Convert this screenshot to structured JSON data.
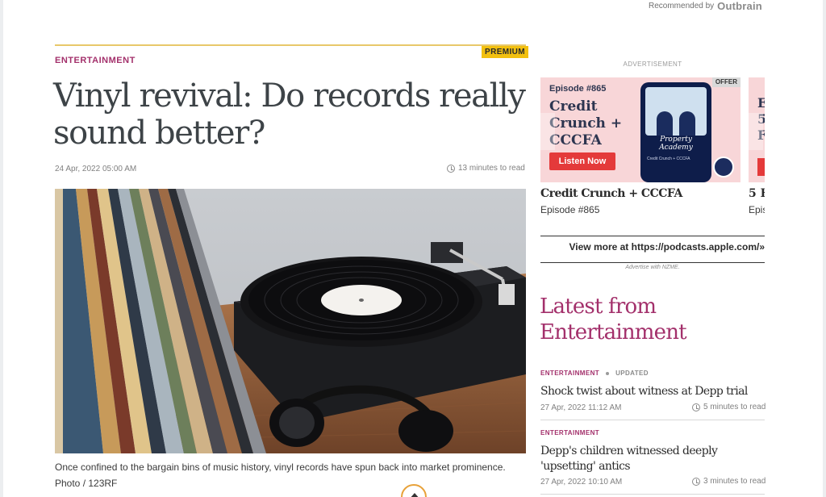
{
  "outbrain": {
    "recommended": "Recommended by",
    "logo": "Outbrain"
  },
  "article": {
    "premium": "PREMIUM",
    "section": "ENTERTAINMENT",
    "headline": "Vinyl revival: Do records really sound better?",
    "date": "24 Apr, 2022 05:00 AM",
    "read_time": "13 minutes to read",
    "caption": "Once confined to the bargain bins of music history, vinyl records have spun back into market prominence. Photo / 123RF"
  },
  "sidebar": {
    "ad_label": "ADVERTISEMENT",
    "ad": {
      "offer": "OFFER",
      "episode": "Episode #865",
      "headline": "Credit Crunch + CCCFA",
      "listen": "Listen Now",
      "phone_brand": "Property Academy",
      "phone_caption": "Credit Crunch + CCCFA",
      "title": "Credit Crunch + CCCFA",
      "subtitle": "Episode #865",
      "card2_fragment": "Ep 5 F",
      "title2": "5 H",
      "subtitle2": "Epis"
    },
    "view_more": "View more at https://podcasts.apple.com/»",
    "advertise": "Advertise with NZME.",
    "latest_heading": "Latest from Entertainment",
    "items": [
      {
        "section": "ENTERTAINMENT",
        "updated": "UPDATED",
        "title": "Shock twist about witness at Depp trial",
        "date": "27 Apr, 2022 11:12 AM",
        "read_time": "5 minutes to read"
      },
      {
        "section": "ENTERTAINMENT",
        "title": "Depp's children witnessed deeply 'upsetting' antics",
        "date": "27 Apr, 2022 10:10 AM",
        "read_time": "3 minutes to read"
      }
    ]
  }
}
